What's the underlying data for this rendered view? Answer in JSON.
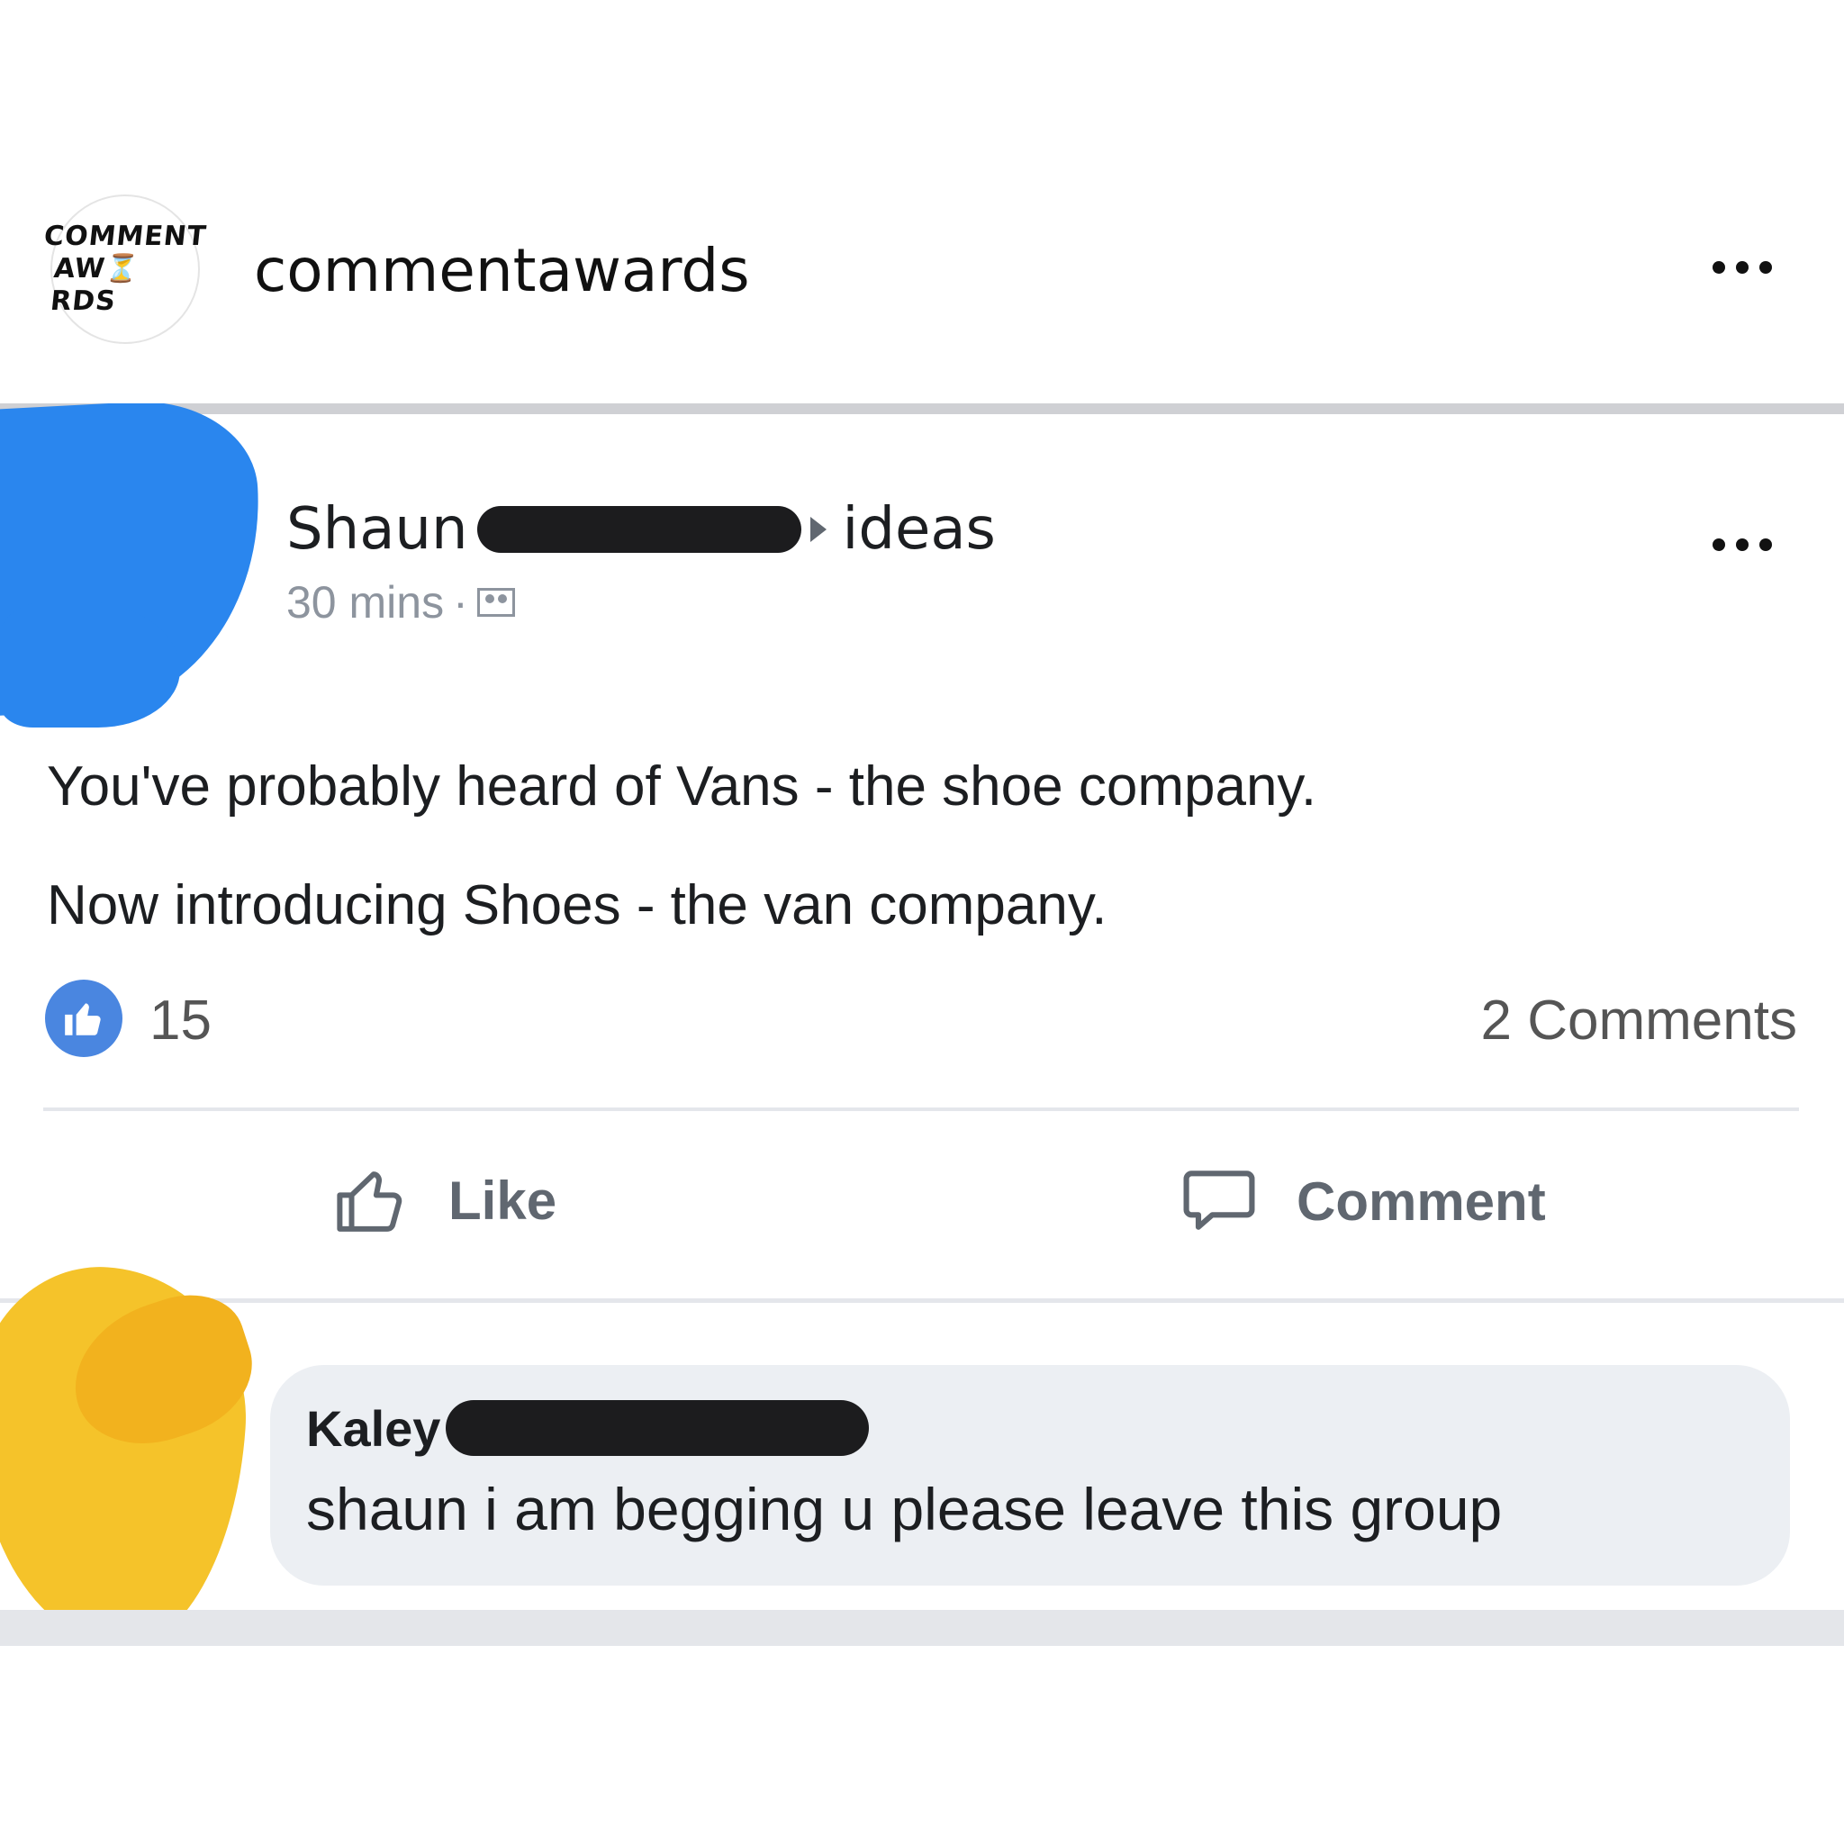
{
  "instagram": {
    "avatar_line1": "COMMENT",
    "avatar_line2": "AW⏳RDS",
    "username": "commentawards"
  },
  "post": {
    "author_first_name": "Shaun",
    "group_name": "ideas",
    "time": "30 mins",
    "text_line1": "You've probably heard of Vans - the shoe company.",
    "text_line2": "Now introducing Shoes - the van company.",
    "like_count": "15",
    "comment_count": "2 Comments",
    "like_label": "Like",
    "comment_label": "Comment"
  },
  "comment": {
    "commenter_first_name": "Kaley",
    "text": "shaun i am begging u please leave this group"
  },
  "colors": {
    "like_badge": "#4a86e0",
    "redaction_blue": "#2a86ee",
    "redaction_yellow": "#f5c32a",
    "comment_bubble": "#eceff3"
  }
}
